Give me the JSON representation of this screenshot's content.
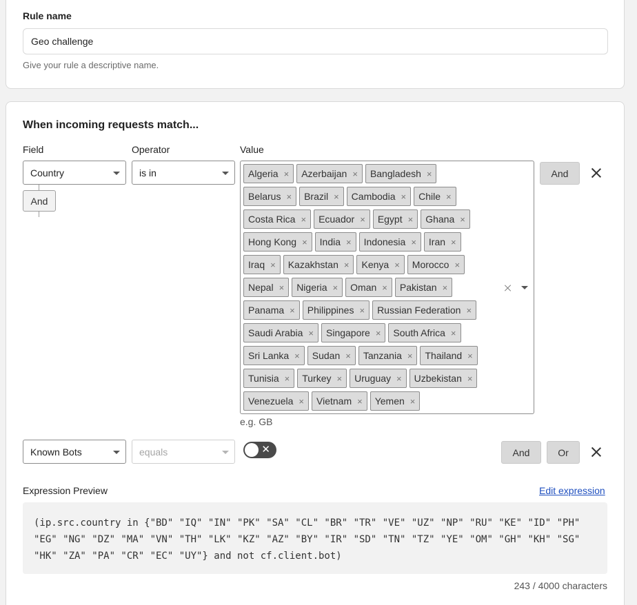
{
  "rule_name": {
    "label": "Rule name",
    "value": "Geo challenge",
    "help": "Give your rule a descriptive name."
  },
  "section_title": "When incoming requests match...",
  "columns": {
    "field": "Field",
    "operator": "Operator",
    "value": "Value"
  },
  "row1": {
    "field": "Country",
    "operator": "is in",
    "values": [
      "Algeria",
      "Azerbaijan",
      "Bangladesh",
      "Belarus",
      "Brazil",
      "Cambodia",
      "Chile",
      "Costa Rica",
      "Ecuador",
      "Egypt",
      "Ghana",
      "Hong Kong",
      "India",
      "Indonesia",
      "Iran",
      "Iraq",
      "Kazakhstan",
      "Kenya",
      "Morocco",
      "Nepal",
      "Nigeria",
      "Oman",
      "Pakistan",
      "Panama",
      "Philippines",
      "Russian Federation",
      "Saudi Arabia",
      "Singapore",
      "South Africa",
      "Sri Lanka",
      "Sudan",
      "Tanzania",
      "Thailand",
      "Tunisia",
      "Turkey",
      "Uruguay",
      "Uzbekistan",
      "Venezuela",
      "Vietnam",
      "Yemen"
    ],
    "value_hint": "e.g. GB",
    "and_button": "And",
    "connector_label": "And"
  },
  "row2": {
    "field": "Known Bots",
    "operator": "equals",
    "toggle_on": false,
    "and_button": "And",
    "or_button": "Or"
  },
  "expression": {
    "label": "Expression Preview",
    "edit_link": "Edit expression",
    "text": "(ip.src.country in {\"BD\" \"IQ\" \"IN\" \"PK\" \"SA\" \"CL\" \"BR\" \"TR\" \"VE\" \"UZ\" \"NP\" \"RU\" \"KE\" \"ID\" \"PH\" \"EG\" \"NG\" \"DZ\" \"MA\" \"VN\" \"TH\" \"LK\" \"KZ\" \"AZ\" \"BY\" \"IR\" \"SD\" \"TN\" \"TZ\" \"YE\" \"OM\" \"GH\" \"KH\" \"SG\" \"HK\" \"ZA\" \"PA\" \"CR\" \"EC\" \"UY\"} and not cf.client.bot)",
    "char_count": "243 / 4000 characters"
  }
}
